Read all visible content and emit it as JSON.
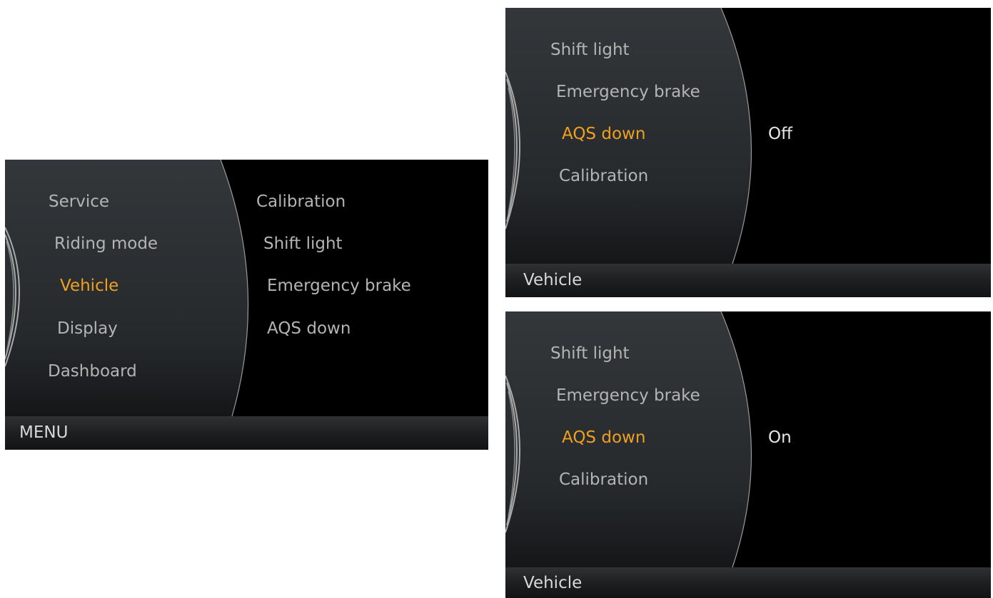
{
  "screen_menu": {
    "menu_items": [
      "Service",
      "Riding mode",
      "Vehicle",
      "Display",
      "Dashboard"
    ],
    "selected": "Vehicle",
    "submenu_items": [
      "Calibration",
      "Shift light",
      "Emergency brake",
      "AQS down"
    ],
    "footer": "MENU"
  },
  "screen_off": {
    "menu_items": [
      "Shift light",
      "Emergency brake",
      "AQS down",
      "Calibration"
    ],
    "selected": "AQS down",
    "value": "Off",
    "footer": "Vehicle"
  },
  "screen_on": {
    "menu_items": [
      "Shift light",
      "Emergency brake",
      "AQS down",
      "Calibration"
    ],
    "selected": "AQS down",
    "value": "On",
    "footer": "Vehicle"
  },
  "colors": {
    "selected_text": "#f0a020",
    "menu_text": "#b4b4b4",
    "background": "#000000",
    "panel": "#2a2d30"
  }
}
